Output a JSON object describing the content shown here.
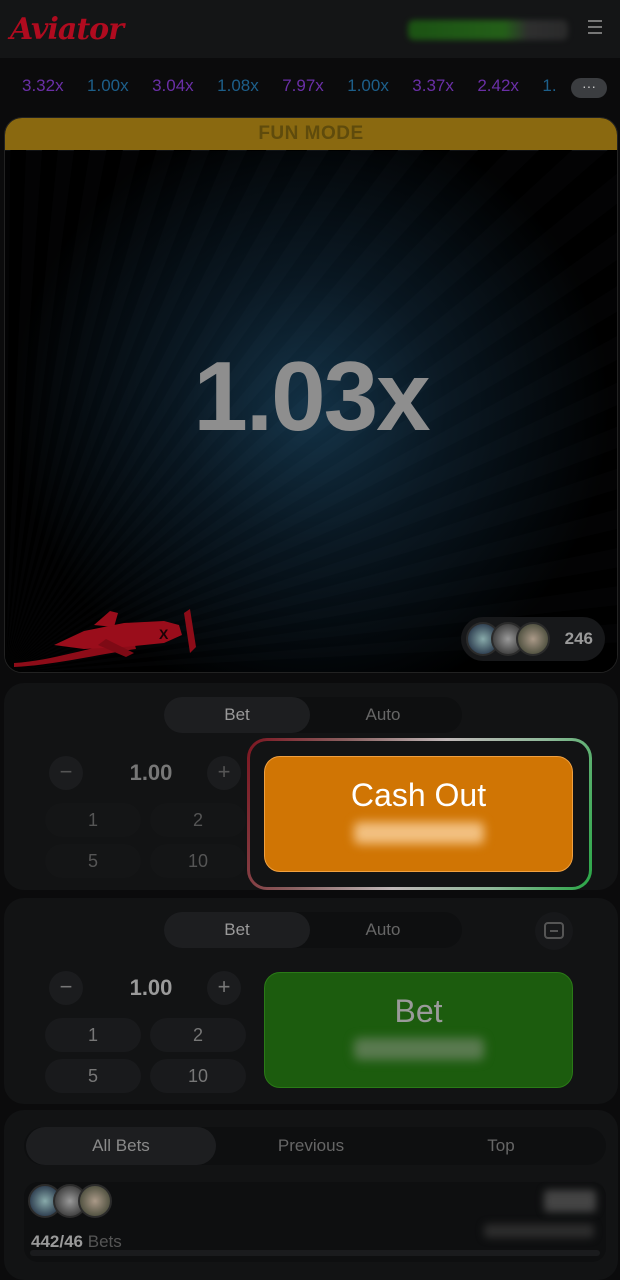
{
  "header": {
    "logo": "Aviator",
    "menu_icon": "hamburger-menu-icon"
  },
  "history": {
    "items": [
      {
        "value": "3.32x",
        "color": "#6a2fa6"
      },
      {
        "value": "1.00x",
        "color": "#1d5f8a"
      },
      {
        "value": "3.04x",
        "color": "#6a2fa6"
      },
      {
        "value": "1.08x",
        "color": "#1d5f8a"
      },
      {
        "value": "7.97x",
        "color": "#6a2fa6"
      },
      {
        "value": "1.00x",
        "color": "#1d5f8a"
      },
      {
        "value": "3.37x",
        "color": "#6a2fa6"
      },
      {
        "value": "2.42x",
        "color": "#6a2fa6"
      },
      {
        "value": "1.",
        "color": "#1d5f8a"
      }
    ],
    "more_label": "···"
  },
  "game": {
    "banner": "FUN MODE",
    "multiplier": "1.03x",
    "players_count": "246"
  },
  "bet_panel_1": {
    "tabs": [
      "Bet",
      "Auto"
    ],
    "amount": "1.00",
    "minus": "−",
    "plus": "+",
    "chips": [
      "1",
      "2",
      "5",
      "10"
    ],
    "action_label": "Cash Out"
  },
  "bet_panel_2": {
    "tabs": [
      "Bet",
      "Auto"
    ],
    "amount": "1.00",
    "minus": "−",
    "plus": "+",
    "chips": [
      "1",
      "2",
      "5",
      "10"
    ],
    "action_label": "Bet"
  },
  "bets_list": {
    "tabs": [
      "All Bets",
      "Previous",
      "Top"
    ],
    "count": "442/46",
    "count_suffix": "Bets"
  },
  "colors": {
    "brand": "#b00b1f",
    "cashout": "#d07504",
    "bet": "#1c5c0e",
    "fun_mode": "#8a6910"
  }
}
